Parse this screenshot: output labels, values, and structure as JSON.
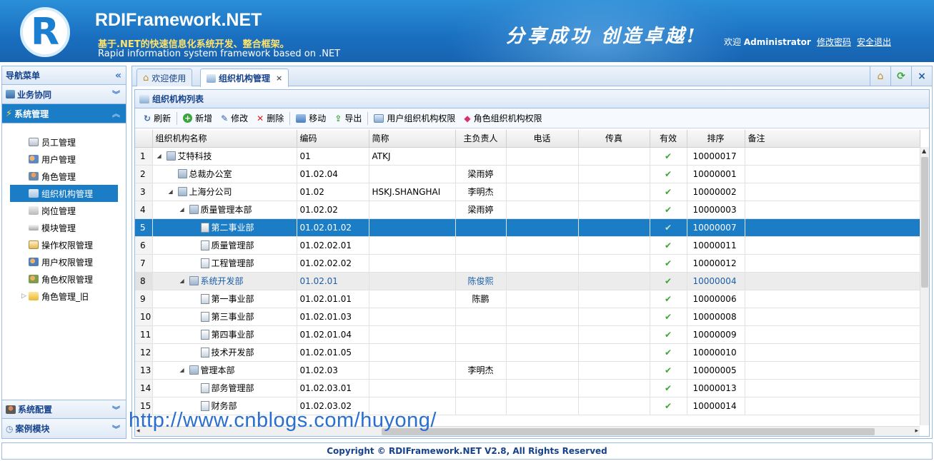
{
  "header": {
    "logo_letter": "R",
    "brand": "RDIFramework.NET",
    "tagline_cn": "基于.NET的快速信息化系统开发、整合框架。",
    "tagline_en": "Rapid information system framework based on .NET",
    "slogan": "分享成功  创造卓越!",
    "welcome_prefix": "欢迎",
    "username": "Administrator",
    "change_password": "修改密码",
    "logout": "安全退出"
  },
  "sidebar": {
    "title": "导航菜单",
    "collapse_icon": "double-chevron-left",
    "sections": [
      {
        "label": "业务协同",
        "active": false
      },
      {
        "label": "系统管理",
        "active": true
      }
    ],
    "items": [
      {
        "label": "员工管理"
      },
      {
        "label": "用户管理"
      },
      {
        "label": "角色管理"
      },
      {
        "label": "组织机构管理",
        "selected": true
      },
      {
        "label": "岗位管理"
      },
      {
        "label": "模块管理"
      },
      {
        "label": "操作权限管理"
      },
      {
        "label": "用户权限管理"
      },
      {
        "label": "角色权限管理"
      },
      {
        "label": "角色管理_旧"
      }
    ],
    "bottom_sections": [
      {
        "label": "系统配置"
      },
      {
        "label": "案例模块"
      }
    ]
  },
  "tabs": [
    {
      "label": "欢迎使用"
    },
    {
      "label": "组织机构管理",
      "active": true,
      "close": "×"
    }
  ],
  "tab_tools": {
    "home": "⌂",
    "refresh": "⟳",
    "close": "×"
  },
  "panel": {
    "title": "组织机构列表"
  },
  "toolbar": {
    "refresh": "刷新",
    "add": "新增",
    "edit": "修改",
    "delete": "删除",
    "move": "移动",
    "export": "导出",
    "user_org_perm": "用户组织机构权限",
    "role_org_perm": "角色组织机构权限"
  },
  "grid": {
    "columns": [
      "组织机构名称",
      "编码",
      "简称",
      "主负责人",
      "电话",
      "传真",
      "有效",
      "排序",
      "备注"
    ],
    "rows": [
      {
        "n": "1",
        "name": "艾特科技",
        "level": 0,
        "expand": true,
        "type": "org",
        "code": "01",
        "short": "ATKJ",
        "manager": "",
        "phone": "",
        "fax": "",
        "valid": "✔",
        "sort": "10000017",
        "remark": ""
      },
      {
        "n": "2",
        "name": "总裁办公室",
        "level": 1,
        "expand": false,
        "type": "org",
        "code": "01.02.04",
        "short": "",
        "manager": "梁雨婷",
        "phone": "",
        "fax": "",
        "valid": "✔",
        "sort": "10000001",
        "remark": ""
      },
      {
        "n": "3",
        "name": "上海分公司",
        "level": 1,
        "expand": true,
        "type": "org",
        "code": "01.02",
        "short": "HSKJ.SHANGHAI",
        "manager": "李明杰",
        "phone": "",
        "fax": "",
        "valid": "✔",
        "sort": "10000002",
        "remark": ""
      },
      {
        "n": "4",
        "name": "质量管理本部",
        "level": 2,
        "expand": true,
        "type": "org",
        "code": "01.02.02",
        "short": "",
        "manager": "梁雨婷",
        "phone": "",
        "fax": "",
        "valid": "✔",
        "sort": "10000003",
        "remark": ""
      },
      {
        "n": "5",
        "name": "第二事业部",
        "level": 3,
        "expand": false,
        "type": "dept",
        "code": "01.02.01.02",
        "short": "",
        "manager": "",
        "phone": "",
        "fax": "",
        "valid": "✔",
        "sort": "10000007",
        "remark": "",
        "selected": true
      },
      {
        "n": "6",
        "name": "质量管理部",
        "level": 3,
        "expand": false,
        "type": "dept",
        "code": "01.02.02.01",
        "short": "",
        "manager": "",
        "phone": "",
        "fax": "",
        "valid": "✔",
        "sort": "10000011",
        "remark": ""
      },
      {
        "n": "7",
        "name": "工程管理部",
        "level": 3,
        "expand": false,
        "type": "dept",
        "code": "01.02.02.02",
        "short": "",
        "manager": "",
        "phone": "",
        "fax": "",
        "valid": "✔",
        "sort": "10000012",
        "remark": ""
      },
      {
        "n": "8",
        "name": "系统开发部",
        "level": 2,
        "expand": true,
        "type": "org",
        "code": "01.02.01",
        "short": "",
        "manager": "陈俊熙",
        "phone": "",
        "fax": "",
        "valid": "✔",
        "sort": "10000004",
        "remark": "",
        "hover": true
      },
      {
        "n": "9",
        "name": "第一事业部",
        "level": 3,
        "expand": false,
        "type": "dept",
        "code": "01.02.01.01",
        "short": "",
        "manager": "陈鹏",
        "phone": "",
        "fax": "",
        "valid": "✔",
        "sort": "10000006",
        "remark": ""
      },
      {
        "n": "10",
        "name": "第三事业部",
        "level": 3,
        "expand": false,
        "type": "dept",
        "code": "01.02.01.03",
        "short": "",
        "manager": "",
        "phone": "",
        "fax": "",
        "valid": "✔",
        "sort": "10000008",
        "remark": ""
      },
      {
        "n": "11",
        "name": "第四事业部",
        "level": 3,
        "expand": false,
        "type": "dept",
        "code": "01.02.01.04",
        "short": "",
        "manager": "",
        "phone": "",
        "fax": "",
        "valid": "✔",
        "sort": "10000009",
        "remark": ""
      },
      {
        "n": "12",
        "name": "技术开发部",
        "level": 3,
        "expand": false,
        "type": "dept",
        "code": "01.02.01.05",
        "short": "",
        "manager": "",
        "phone": "",
        "fax": "",
        "valid": "✔",
        "sort": "10000010",
        "remark": ""
      },
      {
        "n": "13",
        "name": "管理本部",
        "level": 2,
        "expand": true,
        "type": "org",
        "code": "01.02.03",
        "short": "",
        "manager": "李明杰",
        "phone": "",
        "fax": "",
        "valid": "✔",
        "sort": "10000005",
        "remark": ""
      },
      {
        "n": "14",
        "name": "部务管理部",
        "level": 3,
        "expand": false,
        "type": "dept",
        "code": "01.02.03.01",
        "short": "",
        "manager": "",
        "phone": "",
        "fax": "",
        "valid": "✔",
        "sort": "10000013",
        "remark": ""
      },
      {
        "n": "15",
        "name": "财务部",
        "level": 3,
        "expand": false,
        "type": "dept",
        "code": "01.02.03.02",
        "short": "",
        "manager": "",
        "phone": "",
        "fax": "",
        "valid": "✔",
        "sort": "10000014",
        "remark": ""
      }
    ]
  },
  "watermark": "http://www.cnblogs.com/huyong/",
  "footer": "Copyright © RDIFramework.NET V2.8, All Rights Reserved",
  "colors": {
    "header_blue": "#1a6fc0",
    "selection_blue": "#1a7dc6",
    "border": "#99bbe8",
    "title_text": "#15428b",
    "check_green": "#3aa63a"
  }
}
